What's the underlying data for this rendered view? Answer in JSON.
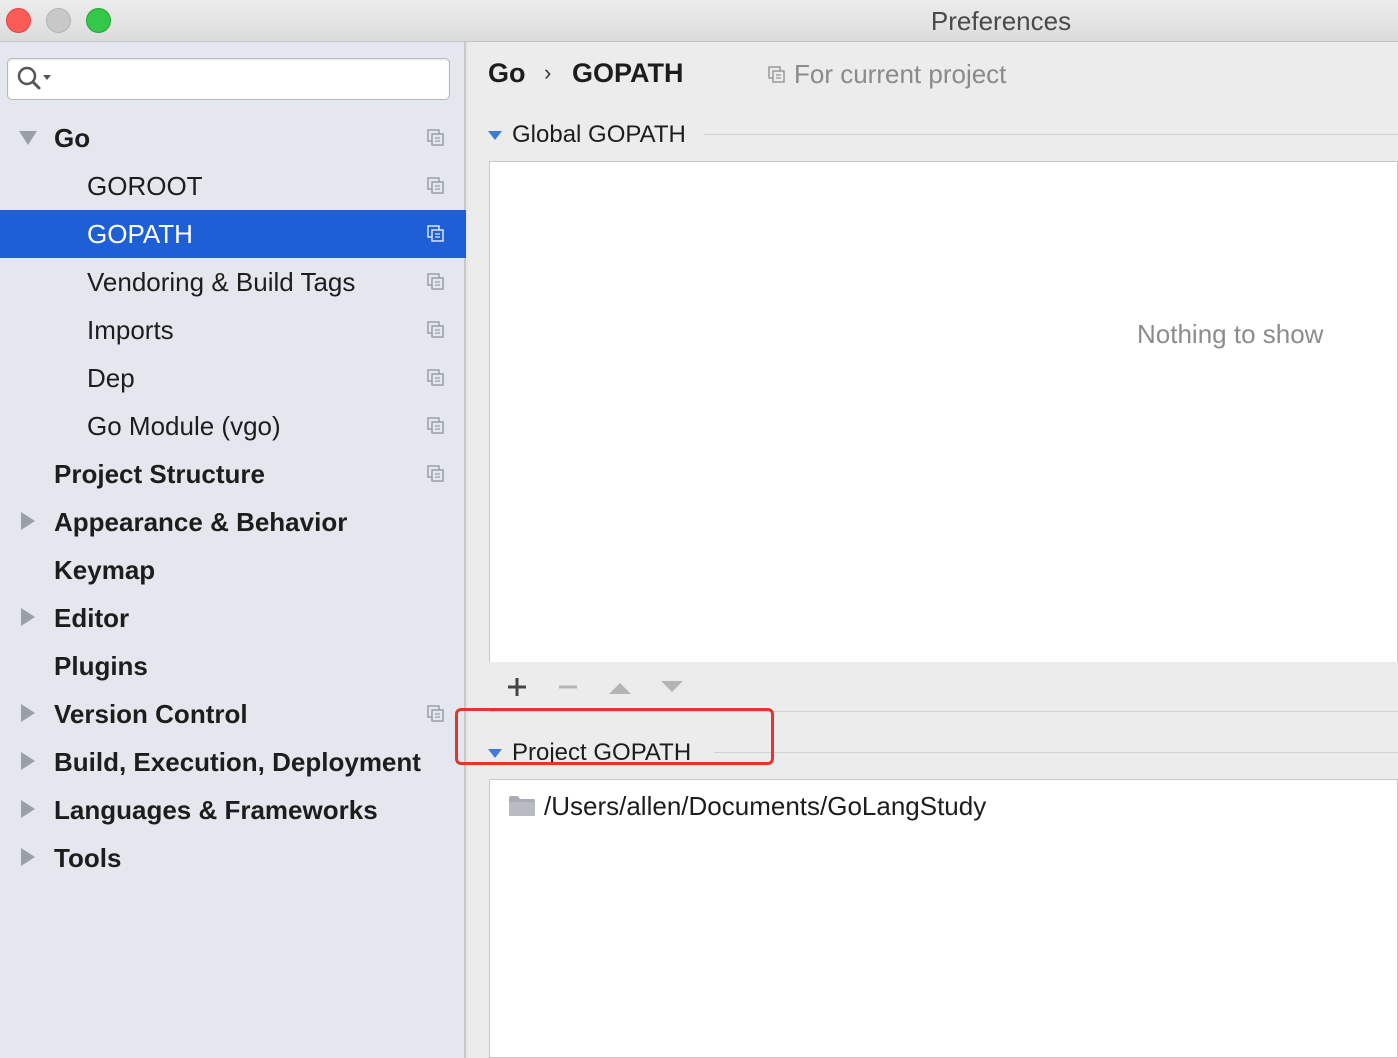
{
  "window": {
    "title": "Preferences"
  },
  "search": {
    "placeholder": "",
    "icon": "search-icon"
  },
  "sidebar": {
    "items": [
      {
        "label": "Go",
        "bold": true,
        "expandable": true,
        "expanded": true,
        "copy_icon": true
      },
      {
        "label": "GOROOT",
        "bold": false,
        "expandable": false,
        "copy_icon": true
      },
      {
        "label": "GOPATH",
        "bold": false,
        "expandable": false,
        "copy_icon": true,
        "selected": true
      },
      {
        "label": "Vendoring & Build Tags",
        "bold": false,
        "expandable": false,
        "copy_icon": true
      },
      {
        "label": "Imports",
        "bold": false,
        "expandable": false,
        "copy_icon": true
      },
      {
        "label": "Dep",
        "bold": false,
        "expandable": false,
        "copy_icon": true
      },
      {
        "label": "Go Module (vgo)",
        "bold": false,
        "expandable": false,
        "copy_icon": true
      },
      {
        "label": "Project Structure",
        "bold": true,
        "expandable": false,
        "copy_icon": true
      },
      {
        "label": "Appearance & Behavior",
        "bold": true,
        "expandable": true,
        "expanded": false,
        "copy_icon": false
      },
      {
        "label": "Keymap",
        "bold": true,
        "expandable": false,
        "copy_icon": false
      },
      {
        "label": "Editor",
        "bold": true,
        "expandable": true,
        "expanded": false,
        "copy_icon": false
      },
      {
        "label": "Plugins",
        "bold": true,
        "expandable": false,
        "copy_icon": false
      },
      {
        "label": "Version Control",
        "bold": true,
        "expandable": true,
        "expanded": false,
        "copy_icon": true
      },
      {
        "label": "Build, Execution, Deployment",
        "bold": true,
        "expandable": true,
        "expanded": false,
        "copy_icon": false
      },
      {
        "label": "Languages & Frameworks",
        "bold": true,
        "expandable": true,
        "expanded": false,
        "copy_icon": false
      },
      {
        "label": "Tools",
        "bold": true,
        "expandable": true,
        "expanded": false,
        "copy_icon": false
      }
    ]
  },
  "breadcrumb": {
    "parent": "Go",
    "separator": "›",
    "current": "GOPATH"
  },
  "scope_label": "For current project",
  "global_gopath": {
    "title": "Global GOPATH",
    "empty_text": "Nothing to show",
    "toolbar": {
      "add_label": "+",
      "remove_label": "−"
    }
  },
  "project_gopath": {
    "title": "Project GOPATH",
    "paths": [
      "/Users/allen/Documents/GoLangStudy"
    ]
  },
  "colors": {
    "selection": "#1f5fd6",
    "highlight_box": "#e8322d",
    "section_triangle": "#3d7bd9"
  }
}
